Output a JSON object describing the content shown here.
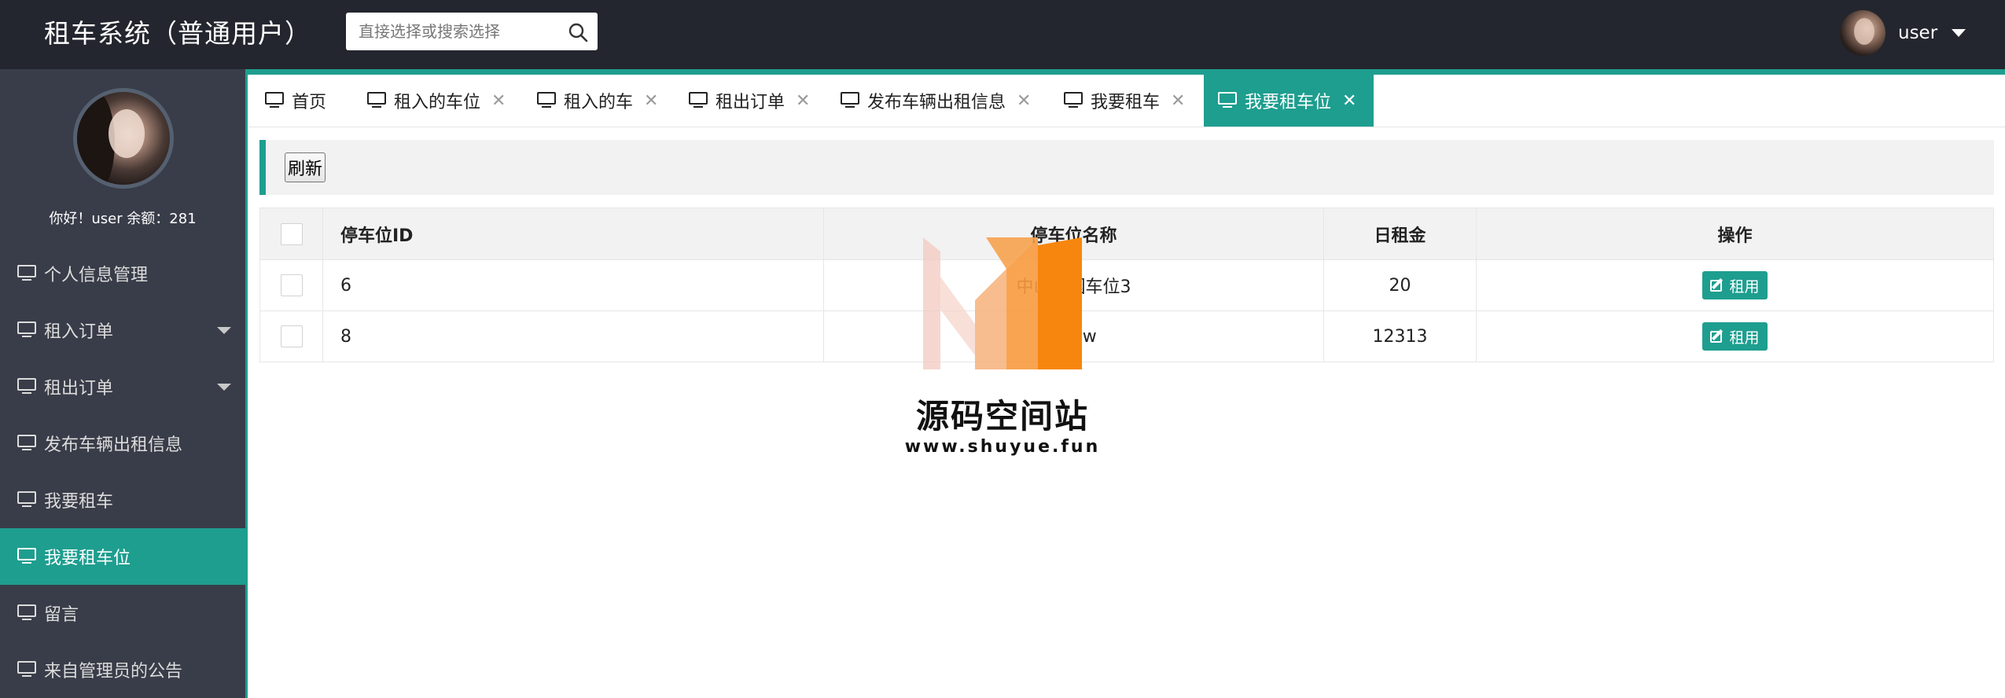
{
  "header": {
    "title": "租车系统（普通用户）",
    "search_placeholder": "直接选择或搜索选择",
    "user_name": "user"
  },
  "sidebar": {
    "greeting": "你好！user 余额：281",
    "items": [
      {
        "label": "个人信息管理",
        "has_arrow": false,
        "active": false
      },
      {
        "label": "租入订单",
        "has_arrow": true,
        "active": false
      },
      {
        "label": "租出订单",
        "has_arrow": true,
        "active": false
      },
      {
        "label": "发布车辆出租信息",
        "has_arrow": false,
        "active": false
      },
      {
        "label": "我要租车",
        "has_arrow": false,
        "active": false
      },
      {
        "label": "我要租车位",
        "has_arrow": false,
        "active": true
      },
      {
        "label": "留言",
        "has_arrow": false,
        "active": false
      },
      {
        "label": "来自管理员的公告",
        "has_arrow": false,
        "active": false
      }
    ]
  },
  "tabs": [
    {
      "label": "首页",
      "closable": false,
      "active": false
    },
    {
      "label": "租入的车位",
      "closable": true,
      "active": false
    },
    {
      "label": "租入的车",
      "closable": true,
      "active": false
    },
    {
      "label": "租出订单",
      "closable": true,
      "active": false
    },
    {
      "label": "发布车辆出租信息",
      "closable": true,
      "active": false
    },
    {
      "label": "我要租车",
      "closable": true,
      "active": false
    },
    {
      "label": "我要租车位",
      "closable": true,
      "active": true
    }
  ],
  "tab_close_glyph": "✕",
  "toolbar": {
    "refresh_label": "刷新"
  },
  "table": {
    "columns": [
      "停车位ID",
      "停车位名称",
      "日租金",
      "操作"
    ],
    "rows": [
      {
        "id": "6",
        "name": "中山公园车位3",
        "rent": "20",
        "action": "租用"
      },
      {
        "id": "8",
        "name": "aaaw",
        "rent": "12313",
        "action": "租用"
      }
    ]
  },
  "watermark": {
    "title": "源码空间站",
    "url": "www.shuyue.fun"
  },
  "colors": {
    "accent": "#1e9e8f",
    "header_bg": "#23262e",
    "sidebar_bg": "#393d49"
  }
}
